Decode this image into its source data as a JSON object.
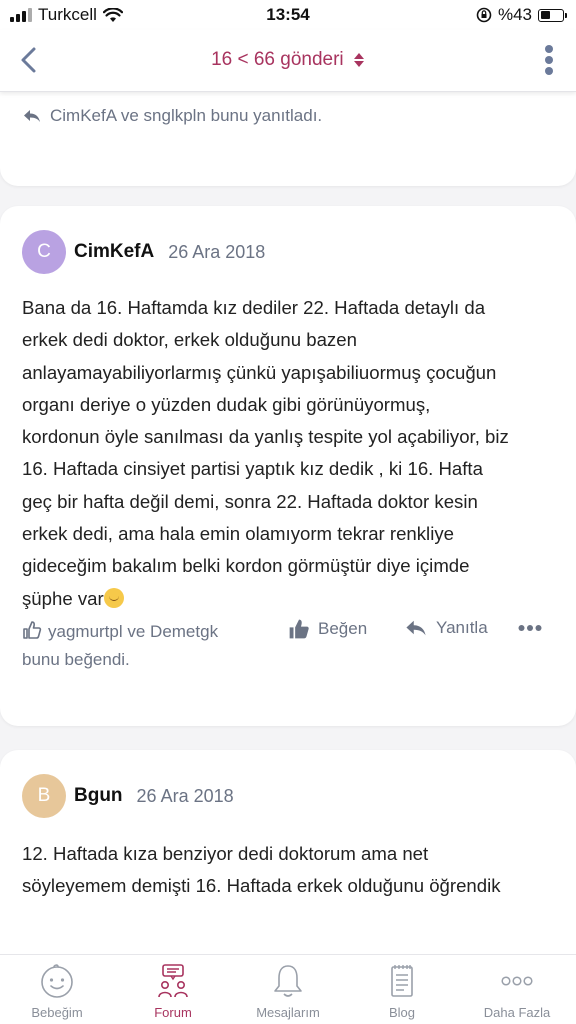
{
  "status_bar": {
    "carrier": "Turkcell",
    "time": "13:54",
    "battery": "%43",
    "battery_level": 0.43
  },
  "header": {
    "title": "16 < 66 gönderi",
    "back_icon": "chevron-left-icon",
    "menu_icon": "more-vertical-icon",
    "sort_icon": "sort-updown-icon"
  },
  "colors": {
    "accent": "#a8345f",
    "muted": "#6b7384",
    "avatar_c": "#b9a2e2",
    "avatar_b": "#e7c79a"
  },
  "previous_post": {
    "replied_text": "CimKefA ve snglkpln bunu yanıtladı."
  },
  "post": {
    "avatar_letter": "C",
    "author": "CimKefA",
    "date": "26 Ara 2018",
    "body_lines": [
      "Bana da 16. Haftamda kız dediler 22. Haftada detaylı da",
      "erkek dedi doktor, erkek olduğunu bazen",
      "anlayamayabiliyorlarmış çünkü yapışabiliuormuş çocuğun",
      "organı deriye o yüzden dudak gibi görünüyormuş,",
      "kordonun öyle sanılması da yanlış tespite yol açabiliyor, biz",
      "16. Haftada cinsiyet partisi yaptık kız dedik , ki 16. Hafta",
      "geç bir hafta değil demi, sonra 22. Haftada doktor kesin",
      "erkek dedi, ama hala emin olamıyorm tekrar renkliye",
      "gideceğim bakalım belki kordon görmüştür diye içimde",
      "şüphe var"
    ],
    "emoji": "relieved-face-emoji",
    "likers_line1": "yagmurtpl ve Demetgk",
    "likers_line2": "bunu beğendi.",
    "like_label": "Beğen",
    "reply_label": "Yanıtla"
  },
  "next_post": {
    "avatar_letter": "B",
    "author": "Bgun",
    "date": "26 Ara 2018",
    "body_lines": [
      "12. Haftada kıza benziyor dedi doktorum ama net",
      "söyleyemem demişti 16. Haftada erkek olduğunu öğrendik"
    ]
  },
  "tabs": [
    {
      "label": "Bebeğim",
      "icon": "baby-face-icon"
    },
    {
      "label": "Forum",
      "icon": "forum-people-icon"
    },
    {
      "label": "Mesajlarım",
      "icon": "bell-icon"
    },
    {
      "label": "Blog",
      "icon": "notepad-icon"
    },
    {
      "label": "Daha Fazla",
      "icon": "more-dots-icon"
    }
  ]
}
